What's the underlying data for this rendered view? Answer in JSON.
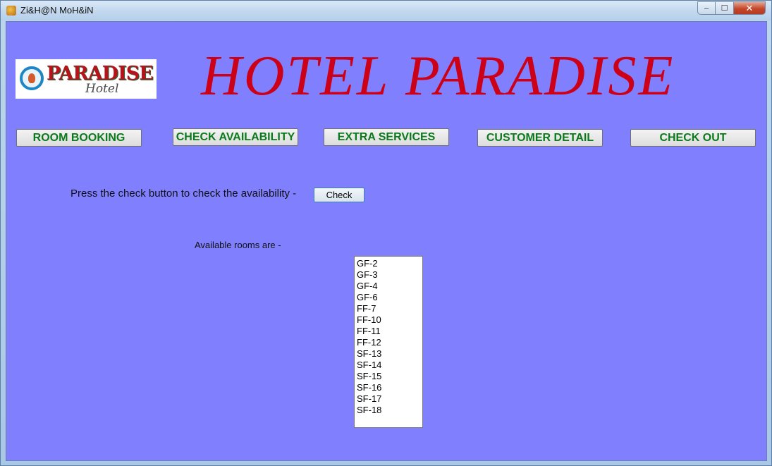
{
  "window": {
    "title": "Zi&H@N MoH&iN",
    "controls": {
      "minimize": "–",
      "maximize": "☐",
      "close": "✕"
    }
  },
  "logo": {
    "word": "PARADISE",
    "sub": "Hotel"
  },
  "header": {
    "title": "HOTEL PARADISE"
  },
  "nav": {
    "room_booking": "ROOM BOOKING",
    "check_availability": "CHECK AVAILABILITY",
    "extra_services": "EXTRA SERVICES",
    "customer_detail": "CUSTOMER DETAIL",
    "check_out": "CHECK OUT"
  },
  "availability": {
    "prompt": "Press the check button to check the availability -",
    "check_label": "Check",
    "rooms_label": "Available rooms are -",
    "rooms": [
      "GF-2",
      "GF-3",
      "GF-4",
      "GF-6",
      "FF-7",
      "FF-10",
      "FF-11",
      "FF-12",
      "SF-13",
      "SF-14",
      "SF-15",
      "SF-16",
      "SF-17",
      "SF-18"
    ]
  },
  "colors": {
    "client_background": "#8080ff",
    "title_red": "#cc0017",
    "nav_text_green": "#0b7a1a"
  }
}
